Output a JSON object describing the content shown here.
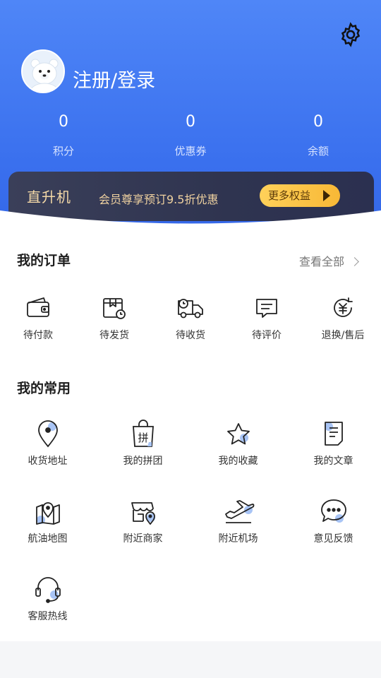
{
  "user": {
    "login_label": "注册/登录"
  },
  "stats": [
    {
      "value": "0",
      "label": "积分"
    },
    {
      "value": "0",
      "label": "优惠券"
    },
    {
      "value": "0",
      "label": "余额"
    }
  ],
  "banner": {
    "title": "直升机",
    "description": "会员尊享预订9.5折优惠",
    "button_label": "更多权益"
  },
  "orders": {
    "title": "我的订单",
    "view_all": "查看全部",
    "items": [
      {
        "label": "待付款",
        "icon": "wallet-icon"
      },
      {
        "label": "待发货",
        "icon": "box-clock-icon"
      },
      {
        "label": "待收货",
        "icon": "truck-icon"
      },
      {
        "label": "待评价",
        "icon": "comment-icon"
      },
      {
        "label": "退换/售后",
        "icon": "refund-icon"
      }
    ]
  },
  "common": {
    "title": "我的常用",
    "items": [
      {
        "label": "收货地址",
        "icon": "location-pin-icon"
      },
      {
        "label": "我的拼团",
        "icon": "shopping-bag-icon"
      },
      {
        "label": "我的收藏",
        "icon": "star-icon"
      },
      {
        "label": "我的文章",
        "icon": "document-icon"
      },
      {
        "label": "航油地图",
        "icon": "map-icon"
      },
      {
        "label": "附近商家",
        "icon": "store-icon"
      },
      {
        "label": "附近机场",
        "icon": "airplane-icon"
      },
      {
        "label": "意见反馈",
        "icon": "feedback-icon"
      },
      {
        "label": "客服热线",
        "icon": "headset-icon"
      }
    ]
  },
  "colors": {
    "primary": "#3a70ee",
    "accent_light": "#a8c4f5",
    "banner_gold": "#f4d9a7"
  }
}
